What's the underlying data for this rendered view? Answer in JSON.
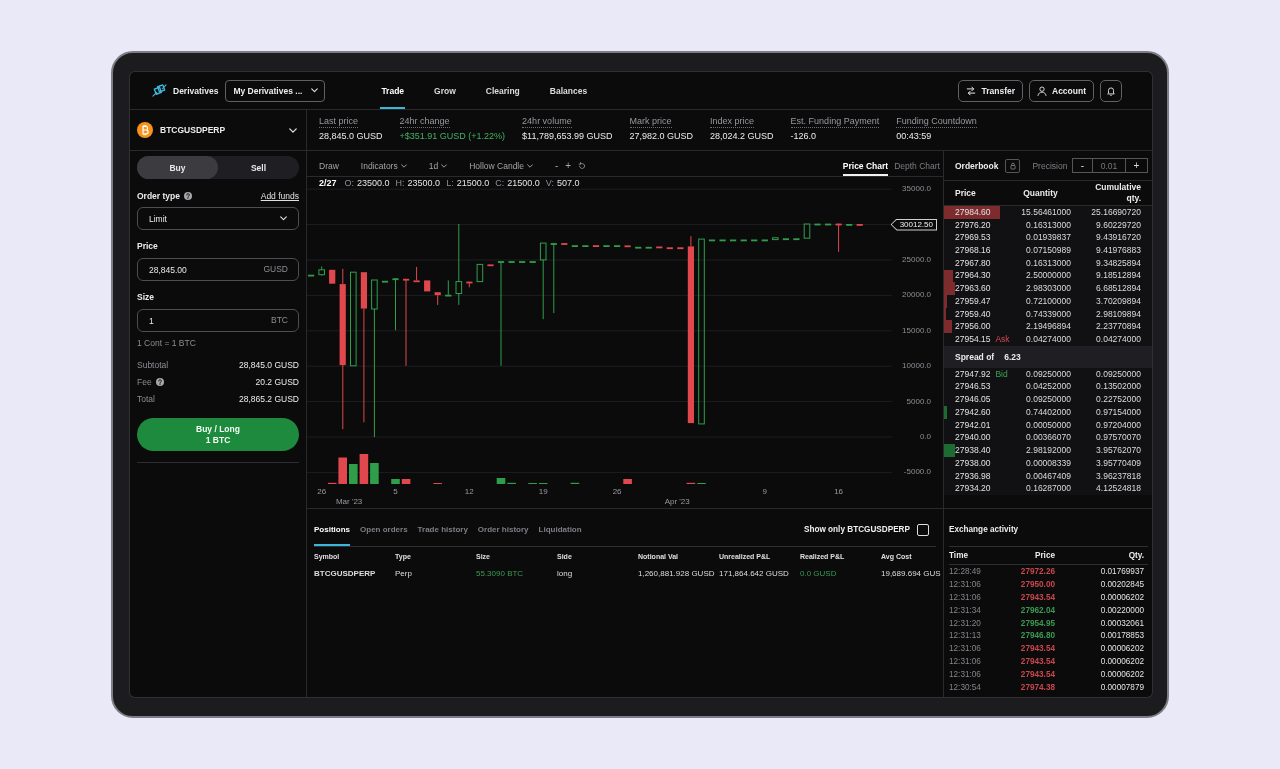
{
  "nav": {
    "brand": "Derivatives",
    "account_menu": "My Derivatives ...",
    "tabs": [
      {
        "label": "Trade",
        "selected": true
      },
      {
        "label": "Grow",
        "selected": false
      },
      {
        "label": "Clearing",
        "selected": false
      },
      {
        "label": "Balances",
        "selected": false
      }
    ],
    "buttons": [
      {
        "label": "Transfer"
      },
      {
        "label": "Account"
      }
    ]
  },
  "order_panel": {
    "symbol": "BTCGUSDPERP",
    "side_toggle": [
      {
        "label": "Buy",
        "selected": true
      },
      {
        "label": "Sell",
        "selected": false
      }
    ],
    "order_type": {
      "label": "Order type",
      "info": true,
      "link": "Add funds",
      "value": "Limit"
    },
    "fields": [
      {
        "label": "Price",
        "value": "28,845.00",
        "unit": "GUSD"
      },
      {
        "label": "Size",
        "value": "1",
        "unit": "BTC"
      }
    ],
    "contract_note": "1 Cont = 1 BTC",
    "summary": [
      {
        "label": "Subtotal",
        "info": false,
        "value": "28,845.0 GUSD"
      },
      {
        "label": "Fee",
        "info": true,
        "value": "20.2 GUSD"
      },
      {
        "label": "Total",
        "info": false,
        "value": "28,865.2 GUSD"
      }
    ],
    "submit": {
      "line_1": "Buy / Long",
      "line_2": "1 BTC"
    }
  },
  "stats": [
    {
      "label": "Last price",
      "value": "28,845.0 GUSD",
      "kind": "value"
    },
    {
      "label": "24hr change",
      "value": "+$351.91 GUSD (+1.22%)",
      "kind": "change"
    },
    {
      "label": "24hr volume",
      "value": "$11,789,653.99 GUSD",
      "kind": "value"
    },
    {
      "label": "Mark price",
      "value": "27,982.0 GUSD",
      "kind": "value"
    },
    {
      "label": "Index price",
      "value": "28,024.2 GUSD",
      "kind": "value"
    },
    {
      "label": "Est. Funding Payment",
      "value": "-126.0",
      "kind": "value"
    },
    {
      "label": "Funding Countdown",
      "value": "00:43:59",
      "kind": "value"
    }
  ],
  "chart": {
    "toolbar": [
      {
        "kind": "button",
        "label": "Draw"
      },
      {
        "kind": "menu",
        "label": "Indicators"
      },
      {
        "kind": "menu",
        "label": "1d"
      },
      {
        "kind": "menu",
        "label": "Hollow Candle"
      }
    ],
    "zoom_controls": [
      "-",
      "+"
    ],
    "views": [
      {
        "label": "Price Chart",
        "selected": true
      },
      {
        "label": "Depth Chart",
        "selected": false
      }
    ],
    "readout": {
      "date": "2/27",
      "fields": [
        {
          "label": "O:",
          "value": "23500.0"
        },
        {
          "label": "H:",
          "value": "23500.0"
        },
        {
          "label": "L:",
          "value": "21500.0"
        },
        {
          "label": "C:",
          "value": "21500.0"
        },
        {
          "label": "V:",
          "value": "507.0"
        }
      ]
    },
    "y_axis": [
      {
        "kind": "tick",
        "label": "35000.0"
      },
      {
        "kind": "tag",
        "label": "30012.50"
      },
      {
        "kind": "tick",
        "label": "25000.0"
      },
      {
        "kind": "tick",
        "label": "20000.0"
      },
      {
        "kind": "tick",
        "label": "15000.0"
      },
      {
        "kind": "tick",
        "label": "10000.0"
      },
      {
        "kind": "tick",
        "label": "5000.0"
      },
      {
        "kind": "tick",
        "label": "0.0"
      },
      {
        "kind": "tick",
        "label": "-5000.0"
      }
    ],
    "x_axis": {
      "days": [
        "26",
        "5",
        "12",
        "19",
        "26",
        "9",
        "16"
      ],
      "months": [
        "Mar '23",
        "Apr '23"
      ]
    }
  },
  "orderbook": {
    "title": "Orderbook",
    "precision_label": "Precision",
    "precision": {
      "decrement": "-",
      "value": "0.01",
      "increment": "+"
    },
    "columns": [
      "Price",
      "Quantity",
      "Cumulative qty."
    ],
    "asks": [
      {
        "price": "27984.60",
        "quantity": "15.56461000",
        "cumulative": "25.16690720",
        "level": 0.27
      },
      {
        "price": "27976.20",
        "quantity": "0.16313000",
        "cumulative": "9.60229720"
      },
      {
        "price": "27969.53",
        "quantity": "0.01939837",
        "cumulative": "9.43916720"
      },
      {
        "price": "27968.16",
        "quantity": "0.07150989",
        "cumulative": "9.41976883"
      },
      {
        "price": "27967.80",
        "quantity": "0.16313000",
        "cumulative": "9.34825894"
      },
      {
        "price": "27964.30",
        "quantity": "2.50000000",
        "cumulative": "9.18512894",
        "level": 0.042
      },
      {
        "price": "27963.60",
        "quantity": "2.98303000",
        "cumulative": "6.68512894",
        "level": 0.052
      },
      {
        "price": "27959.47",
        "quantity": "0.72100000",
        "cumulative": "3.70209894",
        "level": 0.013
      },
      {
        "price": "27959.40",
        "quantity": "0.74339000",
        "cumulative": "2.98109894",
        "level": 0.011
      },
      {
        "price": "27956.00",
        "quantity": "2.19496894",
        "cumulative": "2.23770894",
        "level": 0.037
      },
      {
        "price": "27954.15",
        "tag": "Ask",
        "quantity": "0.04274000",
        "cumulative": "0.04274000"
      }
    ],
    "spread": {
      "label": "Spread of",
      "value": "6.23"
    },
    "bids": [
      {
        "price": "27947.92",
        "tag": "Bid",
        "quantity": "0.09250000",
        "cumulative": "0.09250000"
      },
      {
        "price": "27946.53",
        "quantity": "0.04252000",
        "cumulative": "0.13502000"
      },
      {
        "price": "27946.05",
        "quantity": "0.09250000",
        "cumulative": "0.22752000"
      },
      {
        "price": "27942.60",
        "quantity": "0.74402000",
        "cumulative": "0.97154000",
        "level": 0.013
      },
      {
        "price": "27942.01",
        "quantity": "0.00050000",
        "cumulative": "0.97204000"
      },
      {
        "price": "27940.00",
        "quantity": "0.00366070",
        "cumulative": "0.97570070"
      },
      {
        "price": "27938.40",
        "quantity": "2.98192000",
        "cumulative": "3.95762070",
        "level": 0.052
      },
      {
        "price": "27938.00",
        "quantity": "0.00008339",
        "cumulative": "3.95770409"
      },
      {
        "price": "27936.98",
        "quantity": "0.00467409",
        "cumulative": "3.96237818"
      },
      {
        "price": "27934.20",
        "quantity": "0.16287000",
        "cumulative": "4.12524818"
      }
    ]
  },
  "positions": {
    "tabs": [
      {
        "label": "Positions",
        "selected": true
      },
      {
        "label": "Open orders",
        "selected": false
      },
      {
        "label": "Trade history",
        "selected": false
      },
      {
        "label": "Order history",
        "selected": false
      },
      {
        "label": "Liquidation",
        "selected": false
      }
    ],
    "filter": {
      "label": "Show only BTCGUSDPERP",
      "checked": false
    },
    "columns": [
      "Symbol",
      "Type",
      "Size",
      "Side",
      "Notional Val",
      "Unrealized P&L",
      "Realized P&L",
      "Avg Cost"
    ],
    "rows": [
      {
        "cells": [
          {
            "text": "BTCGUSDPERP",
            "kind": "symbol"
          },
          {
            "text": "Perp",
            "kind": "plain"
          },
          {
            "text": "55.3090 BTC",
            "kind": "positive"
          },
          {
            "text": "long",
            "kind": "plain"
          },
          {
            "text": "1,260,881.928 GUSD",
            "kind": "plain"
          },
          {
            "text": "171,864.642 GUSD",
            "kind": "plain"
          },
          {
            "text": "0.0 GUSD",
            "kind": "positive"
          },
          {
            "text": "19,689.694 GUS",
            "kind": "plain"
          }
        ]
      }
    ]
  },
  "exchange_activity": {
    "title": "Exchange activity",
    "columns": [
      "Time",
      "Price",
      "Qty."
    ],
    "rows": [
      {
        "time": "12:28:49",
        "price": "27972.26",
        "quantity": "0.01769937",
        "color": "#c9474c"
      },
      {
        "time": "12:31:06",
        "price": "27950.00",
        "quantity": "0.00202845",
        "color": "#c9474c"
      },
      {
        "time": "12:31:06",
        "price": "27943.54",
        "quantity": "0.00006202",
        "color": "#c9474c"
      },
      {
        "time": "12:31:34",
        "price": "27962.04",
        "quantity": "0.00220000",
        "color": "#3a9a52"
      },
      {
        "time": "12:31:20",
        "price": "27954.95",
        "quantity": "0.00032061",
        "color": "#3a9a52"
      },
      {
        "time": "12:31:13",
        "price": "27946.80",
        "quantity": "0.00178853",
        "color": "#3a9a52"
      },
      {
        "time": "12:31:06",
        "price": "27943.54",
        "quantity": "0.00006202",
        "color": "#c9474c"
      },
      {
        "time": "12:31:06",
        "price": "27943.54",
        "quantity": "0.00006202",
        "color": "#c9474c"
      },
      {
        "time": "12:31:06",
        "price": "27943.54",
        "quantity": "0.00006202",
        "color": "#c9474c"
      },
      {
        "time": "12:30:54",
        "price": "27974.38",
        "quantity": "0.00007879",
        "color": "#c9474c"
      }
    ]
  }
}
